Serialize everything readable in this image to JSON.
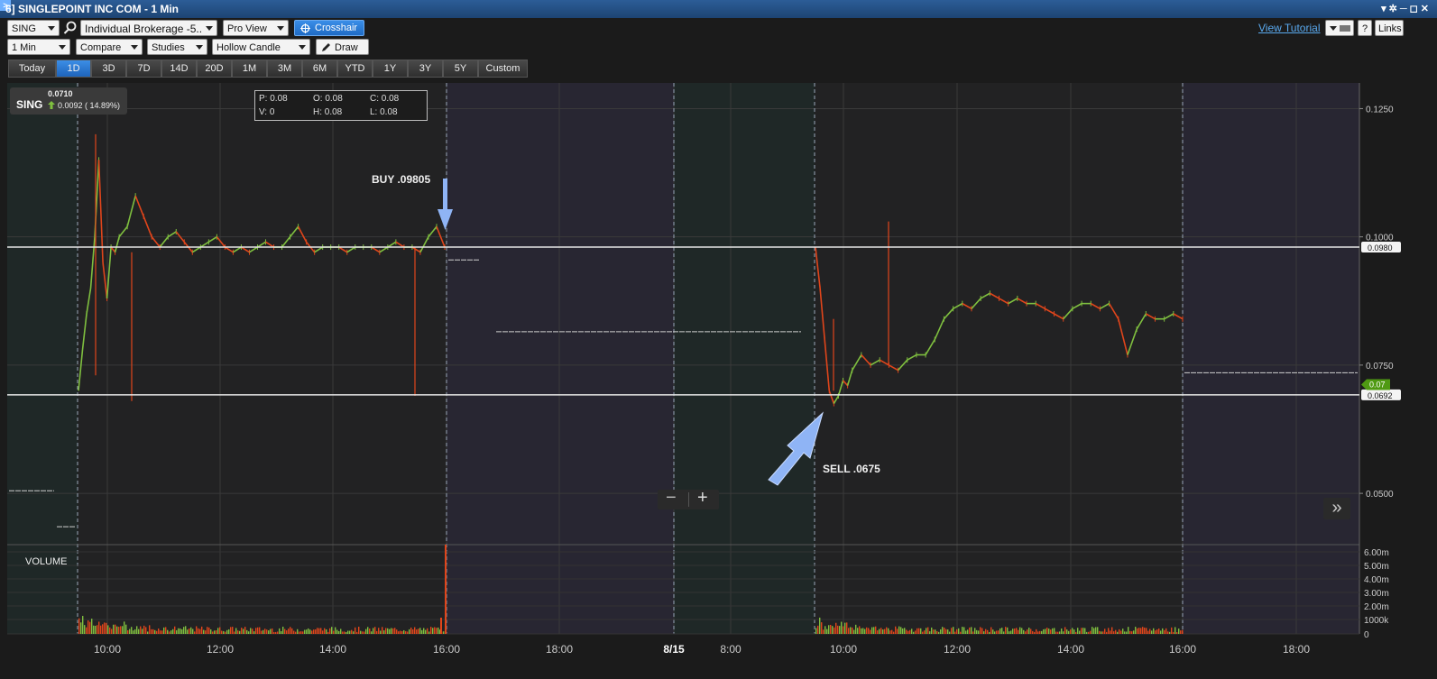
{
  "window": {
    "title": "6] SINGLEPOINT INC COM - 1 Min",
    "controls": "▾✲─◻✕"
  },
  "toolbar": {
    "symbol": "SING",
    "account": "Individual Brokerage -5..",
    "view": "Pro View",
    "crosshair_label": "Crosshair",
    "view_tutorial": "View Tutorial",
    "help": "?",
    "links": "Links"
  },
  "toolbar2": {
    "interval": "1 Min",
    "compare": "Compare",
    "studies": "Studies",
    "chart_type": "Hollow Candle",
    "draw": "Draw"
  },
  "tabs": [
    "Today",
    "1D",
    "3D",
    "7D",
    "14D",
    "20D",
    "1M",
    "3M",
    "6M",
    "YTD",
    "1Y",
    "3Y",
    "5Y",
    "Custom"
  ],
  "active_tab": "1D",
  "quote": {
    "symbol": "SING",
    "price": "0.0710",
    "change": "0.0092 ( 14.89%)"
  },
  "readout": {
    "p": "P: 0.08",
    "o": "O: 0.08",
    "c": "C: 0.08",
    "v": "V: 0",
    "h": "H: 0.08",
    "l": "L: 0.08"
  },
  "annotations": {
    "buy": "BUY .09805",
    "sell": "SELL .0675"
  },
  "volume_label": "VOLUME",
  "zoom": {
    "minus": "−",
    "plus": "+"
  },
  "expand": "»",
  "colors": {
    "up": "#7fbf3f",
    "down": "#e0451b",
    "hline": "#e6e6e6",
    "arrow": "#8fb4f5"
  },
  "chart_data": {
    "type": "candlestick",
    "x_tick_labels": [
      "10:00",
      "12:00",
      "14:00",
      "16:00",
      "18:00",
      "8/15",
      "8:00",
      "10:00",
      "12:00",
      "14:00",
      "16:00",
      "18:00"
    ],
    "price_tick_labels": [
      "0.1250",
      "0.1000",
      "0.0750",
      "0.0500"
    ],
    "price_ylim": [
      0.04,
      0.13
    ],
    "volume_tick_labels": [
      "6.00m",
      "5.00m",
      "4.00m",
      "3.00m",
      "2.00m",
      "1000k",
      "0"
    ],
    "horizontal_lines": [
      {
        "value": 0.098,
        "label": "0.0980"
      },
      {
        "value": 0.0692,
        "label": "0.0692"
      }
    ],
    "last_price_label": "0.07",
    "price_path_day1": [
      [
        0,
        0.07
      ],
      [
        1,
        0.078
      ],
      [
        2,
        0.085
      ],
      [
        3,
        0.09
      ],
      [
        4,
        0.1
      ],
      [
        5,
        0.115
      ],
      [
        6,
        0.095
      ],
      [
        7,
        0.088
      ],
      [
        8,
        0.098
      ],
      [
        9,
        0.097
      ],
      [
        10,
        0.1
      ],
      [
        12,
        0.102
      ],
      [
        14,
        0.108
      ],
      [
        16,
        0.104
      ],
      [
        18,
        0.1
      ],
      [
        20,
        0.098
      ],
      [
        22,
        0.1
      ],
      [
        24,
        0.101
      ],
      [
        26,
        0.099
      ],
      [
        28,
        0.097
      ],
      [
        30,
        0.098
      ],
      [
        32,
        0.099
      ],
      [
        34,
        0.1
      ],
      [
        36,
        0.098
      ],
      [
        38,
        0.097
      ],
      [
        40,
        0.098
      ],
      [
        42,
        0.097
      ],
      [
        44,
        0.098
      ],
      [
        46,
        0.099
      ],
      [
        48,
        0.098
      ],
      [
        50,
        0.098
      ],
      [
        52,
        0.1
      ],
      [
        54,
        0.102
      ],
      [
        56,
        0.099
      ],
      [
        58,
        0.097
      ],
      [
        60,
        0.098
      ],
      [
        62,
        0.098
      ],
      [
        64,
        0.098
      ],
      [
        66,
        0.097
      ],
      [
        68,
        0.098
      ],
      [
        70,
        0.098
      ],
      [
        72,
        0.098
      ],
      [
        74,
        0.097
      ],
      [
        76,
        0.098
      ],
      [
        78,
        0.099
      ],
      [
        80,
        0.098
      ],
      [
        82,
        0.098
      ],
      [
        84,
        0.097
      ],
      [
        86,
        0.1
      ],
      [
        88,
        0.102
      ],
      [
        90,
        0.098
      ]
    ],
    "price_path_day2": [
      [
        0,
        0.098
      ],
      [
        1,
        0.09
      ],
      [
        2,
        0.08
      ],
      [
        3,
        0.07
      ],
      [
        4,
        0.0675
      ],
      [
        5,
        0.069
      ],
      [
        6,
        0.072
      ],
      [
        7,
        0.071
      ],
      [
        8,
        0.074
      ],
      [
        10,
        0.077
      ],
      [
        12,
        0.075
      ],
      [
        14,
        0.076
      ],
      [
        16,
        0.075
      ],
      [
        18,
        0.074
      ],
      [
        20,
        0.076
      ],
      [
        22,
        0.077
      ],
      [
        24,
        0.077
      ],
      [
        26,
        0.08
      ],
      [
        28,
        0.084
      ],
      [
        30,
        0.086
      ],
      [
        32,
        0.087
      ],
      [
        34,
        0.086
      ],
      [
        36,
        0.088
      ],
      [
        38,
        0.089
      ],
      [
        40,
        0.088
      ],
      [
        42,
        0.087
      ],
      [
        44,
        0.088
      ],
      [
        46,
        0.087
      ],
      [
        48,
        0.087
      ],
      [
        50,
        0.086
      ],
      [
        52,
        0.085
      ],
      [
        54,
        0.084
      ],
      [
        56,
        0.086
      ],
      [
        58,
        0.087
      ],
      [
        60,
        0.087
      ],
      [
        62,
        0.086
      ],
      [
        64,
        0.087
      ],
      [
        66,
        0.084
      ],
      [
        68,
        0.077
      ],
      [
        70,
        0.082
      ],
      [
        72,
        0.085
      ],
      [
        74,
        0.084
      ],
      [
        76,
        0.084
      ],
      [
        78,
        0.085
      ],
      [
        80,
        0.084
      ]
    ]
  }
}
